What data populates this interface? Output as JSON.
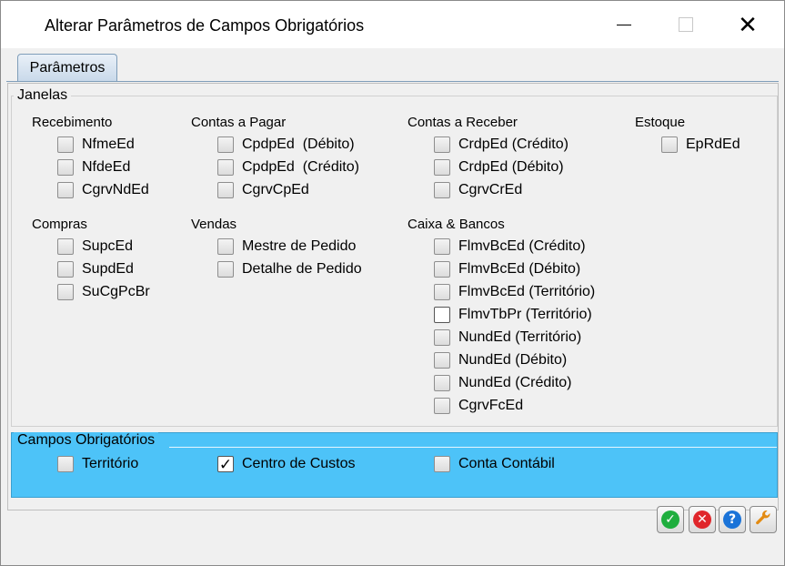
{
  "window": {
    "title": "Alterar Parâmetros de Campos Obrigatórios",
    "min_glyph": "",
    "max_glyph": "",
    "close_glyph": "✕"
  },
  "tabs": [
    {
      "label": "Parâmetros",
      "active": true
    }
  ],
  "janelas": {
    "legend": "Janelas",
    "sections": [
      {
        "title": "Recebimento",
        "items": [
          {
            "label": "NfmeEd",
            "checked": false
          },
          {
            "label": "NfdeEd",
            "checked": false
          },
          {
            "label": "CgrvNdEd",
            "checked": false
          }
        ]
      },
      {
        "title": "Contas a Pagar",
        "items": [
          {
            "label": "CpdpEd  (Débito)",
            "checked": false
          },
          {
            "label": "CpdpEd  (Crédito)",
            "checked": false
          },
          {
            "label": "CgrvCpEd",
            "checked": false
          }
        ]
      },
      {
        "title": "Contas a Receber",
        "items": [
          {
            "label": "CrdpEd (Crédito)",
            "checked": false
          },
          {
            "label": "CrdpEd (Débito)",
            "checked": false
          },
          {
            "label": "CgrvCrEd",
            "checked": false
          }
        ]
      },
      {
        "title": "Estoque",
        "items": [
          {
            "label": "EpRdEd",
            "checked": false
          }
        ]
      },
      {
        "title": "Compras",
        "items": [
          {
            "label": "SupcEd",
            "checked": false
          },
          {
            "label": "SupdEd",
            "checked": false
          },
          {
            "label": "SuCgPcBr",
            "checked": false
          }
        ]
      },
      {
        "title": "Vendas",
        "items": [
          {
            "label": "Mestre de Pedido",
            "checked": false
          },
          {
            "label": "Detalhe de Pedido",
            "checked": false
          }
        ]
      },
      {
        "title": "Caixa & Bancos",
        "items": [
          {
            "label": "FlmvBcEd (Crédito)",
            "checked": false
          },
          {
            "label": "FlmvBcEd (Débito)",
            "checked": false
          },
          {
            "label": "FlmvBcEd (Território)",
            "checked": false
          },
          {
            "label": "FlmvTbPr (Território)",
            "checked": false
          },
          {
            "label": "NundEd (Território)",
            "checked": false
          },
          {
            "label": "NundEd (Débito)",
            "checked": false
          },
          {
            "label": "NundEd (Crédito)",
            "checked": false
          },
          {
            "label": "CgrvFcEd",
            "checked": false
          }
        ]
      }
    ]
  },
  "campos": {
    "legend": "Campos Obrigatórios",
    "items": [
      {
        "label": "Território",
        "checked": false
      },
      {
        "label": "Centro de Custos",
        "checked": true
      },
      {
        "label": "Conta Contábil",
        "checked": false
      }
    ]
  },
  "buttons": {
    "ok_icon": "check-icon",
    "cancel_icon": "x-circle-icon",
    "help_icon": "question-icon",
    "tools_icon": "wrench-icon",
    "ok_glyph": "✓",
    "cancel_glyph": "✕",
    "help_glyph": "?",
    "tools_glyph": "🔧"
  },
  "colors": {
    "campos_bg": "#4dc3f8",
    "ok": "#1fae3e",
    "cancel": "#e0262b",
    "help": "#1a73d8",
    "tools": "#e38b12"
  }
}
